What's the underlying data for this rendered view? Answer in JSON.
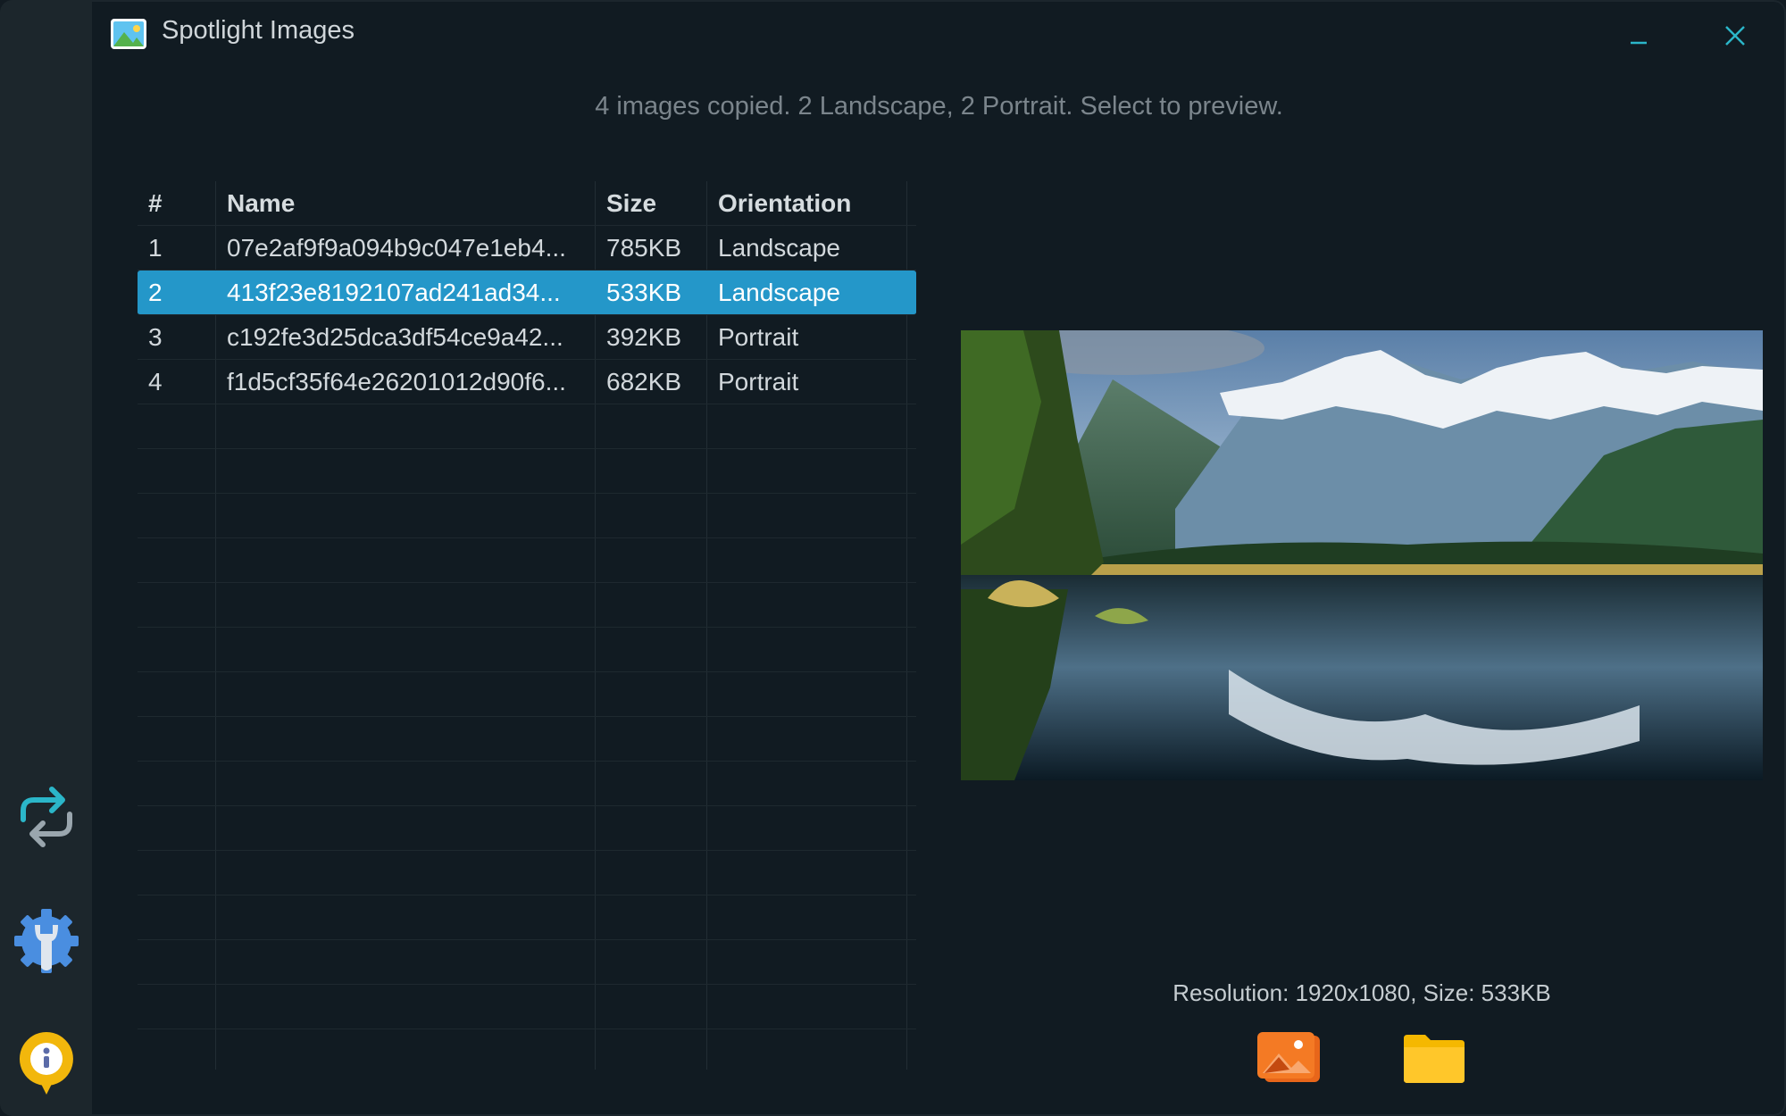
{
  "window": {
    "title": "Spotlight Images",
    "minimize_icon": "minimize-icon",
    "close_icon": "close-icon"
  },
  "sidebar": {
    "items": [
      {
        "icon": "sync-arrows-icon"
      },
      {
        "icon": "settings-wrench-gear-icon"
      },
      {
        "icon": "info-icon"
      }
    ]
  },
  "status_text": "4 images copied. 2 Landscape, 2 Portrait. Select to preview.",
  "table": {
    "columns": [
      "#",
      "Name",
      "Size",
      "Orientation"
    ],
    "rows": [
      {
        "num": "1",
        "name": "07e2af9f9a094b9c047e1eb4...",
        "size": "785KB",
        "orientation": "Landscape"
      },
      {
        "num": "2",
        "name": "413f23e8192107ad241ad34...",
        "size": "533KB",
        "orientation": "Landscape"
      },
      {
        "num": "3",
        "name": "c192fe3d25dca3df54ce9a42...",
        "size": "392KB",
        "orientation": "Portrait"
      },
      {
        "num": "4",
        "name": "f1d5cf35f64e26201012d90f6...",
        "size": "682KB",
        "orientation": "Portrait"
      }
    ],
    "selected_row": 2
  },
  "preview": {
    "info": "Resolution: 1920x1080, Size: 533KB"
  },
  "actions": {
    "set_wallpaper_icon": "image-icon",
    "open_folder_icon": "folder-icon"
  },
  "colors": {
    "accent": "#2497c9",
    "background": "#111b22",
    "sidebar": "#1c262c",
    "window_controls": "#2bb6c9"
  }
}
